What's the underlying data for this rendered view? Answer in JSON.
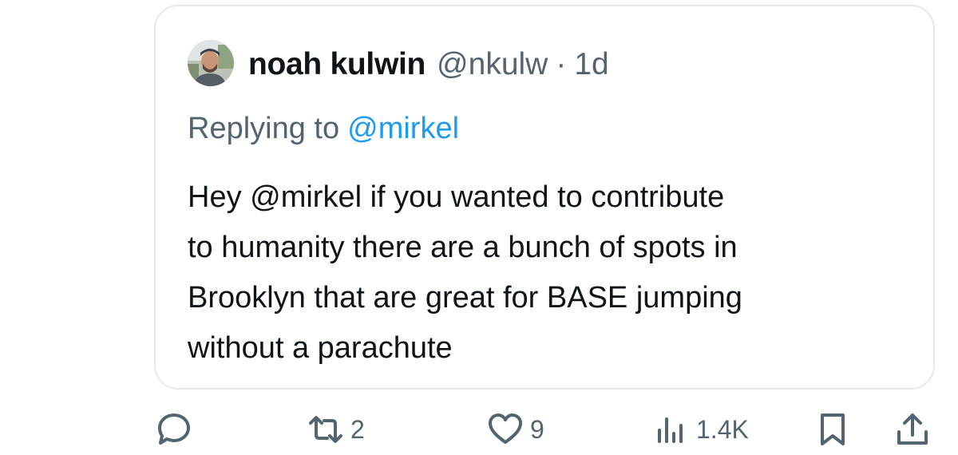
{
  "quote": {
    "author_name": "noah kulwin",
    "author_handle": "@nkulw",
    "separator": "·",
    "time_ago": "1d",
    "replying_prefix": "Replying to",
    "replying_to": "@mirkel",
    "text_lines": [
      "Hey @mirkel if you wanted to contribute",
      "to humanity there are a bunch of spots in",
      "Brooklyn that are great for BASE jumping",
      "without a parachute"
    ]
  },
  "actions": {
    "reply_icon": "reply-bubble-icon",
    "retweet_icon": "retweet-icon",
    "retweet_count": "2",
    "like_icon": "heart-icon",
    "like_count": "9",
    "views_icon": "views-bar-chart-icon",
    "views_count": "1.4K",
    "bookmark_icon": "bookmark-icon",
    "share_icon": "share-upload-icon"
  },
  "colors": {
    "text_primary": "#0f1419",
    "text_secondary": "#536471",
    "link_blue": "#1d9bf0",
    "card_border": "#e6e9ec"
  }
}
